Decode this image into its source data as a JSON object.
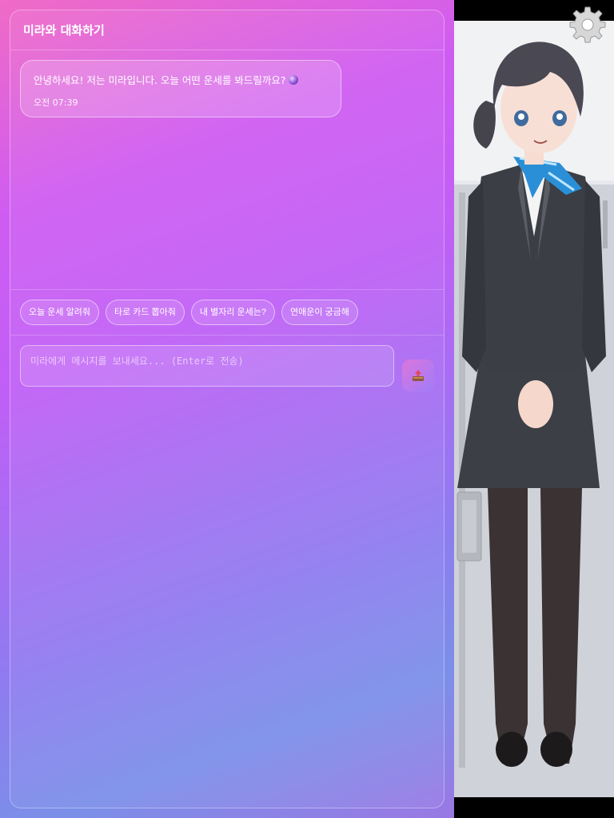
{
  "chat": {
    "title": "미라와 대화하기",
    "messages": [
      {
        "sender": "bot",
        "text": "안녕하세요! 저는 미라입니다. 오늘 어떤 운세를 봐드릴까요?",
        "emoji_icon": "crystal-ball-icon",
        "time": "오전 07:39"
      }
    ]
  },
  "quick_replies": [
    "오늘 운세 알려줘",
    "타로 카드 뽑아줘",
    "내 별자리 운세는?",
    "연애운이 궁금해"
  ],
  "composer": {
    "placeholder": "미라에게 메시지를 보내세요... (Enter로 전송)",
    "value": "",
    "send_icon": "send-tray-icon"
  },
  "settings": {
    "icon": "gear-icon"
  },
  "character": {
    "icon": "character-avatar"
  }
}
